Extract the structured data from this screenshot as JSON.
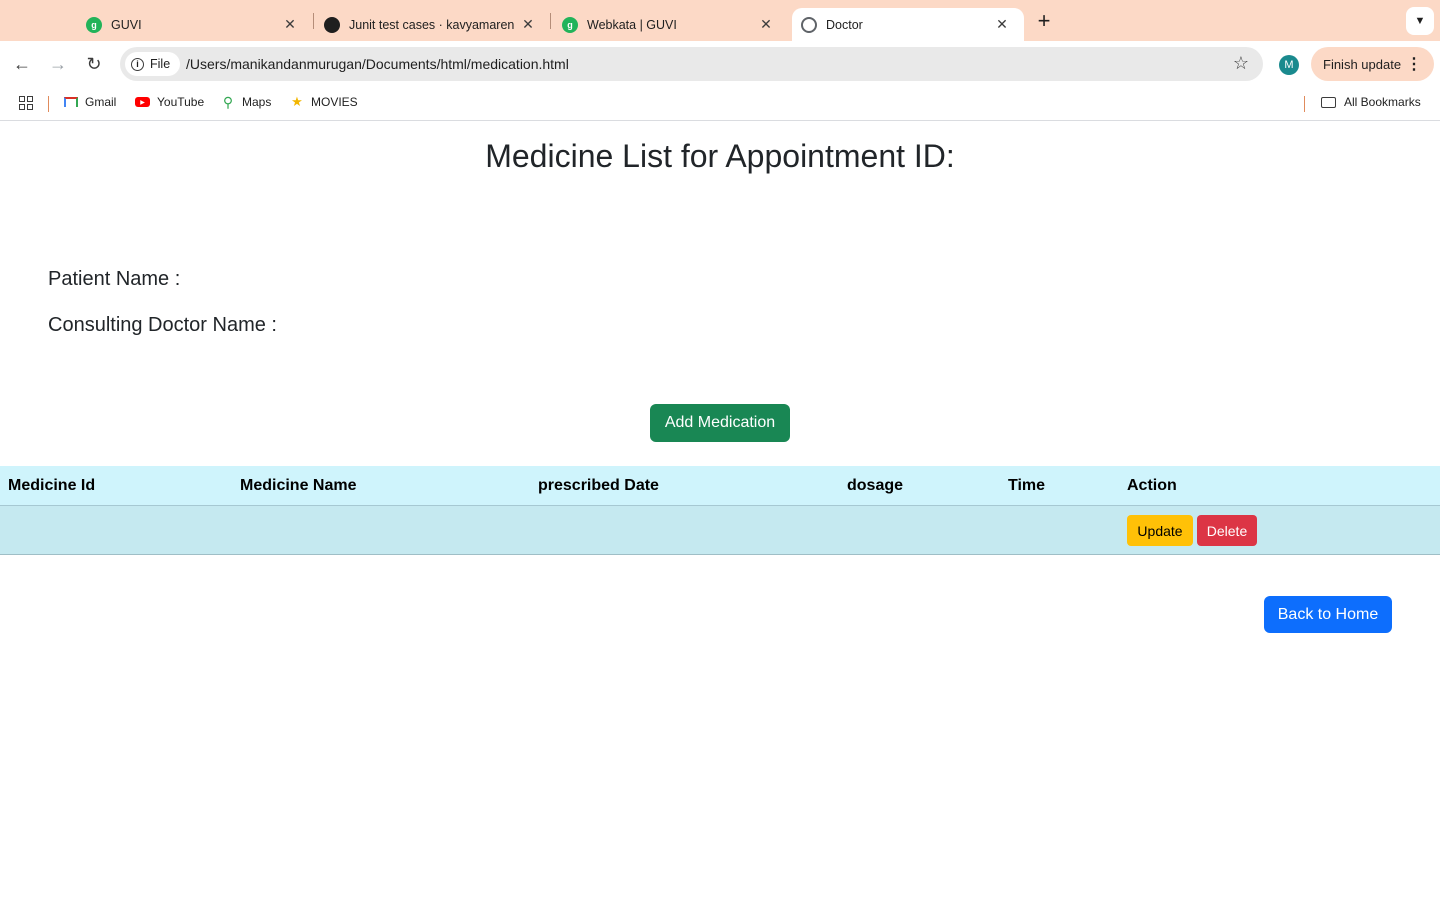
{
  "browser": {
    "tabs": [
      {
        "title": "GUVI",
        "icon": "guvi-icon"
      },
      {
        "title": "Junit test cases · kavyamaren",
        "icon": "github-icon"
      },
      {
        "title": "Webkata | GUVI",
        "icon": "guvi-icon"
      },
      {
        "title": "Doctor",
        "icon": "globe-icon",
        "active": true
      }
    ],
    "address": {
      "chip_label": "File",
      "url": "/Users/manikandanmurugan/Documents/html/medication.html"
    },
    "profile_initial": "M",
    "finish_update_label": "Finish update",
    "bookmarks": [
      {
        "label": "Gmail",
        "icon": "gmail-icon"
      },
      {
        "label": "YouTube",
        "icon": "youtube-icon"
      },
      {
        "label": "Maps",
        "icon": "maps-icon"
      },
      {
        "label": "MOVIES",
        "icon": "movies-icon"
      }
    ],
    "all_bookmarks_label": "All Bookmarks",
    "colors": {
      "tabstrip": "#fcd9c6"
    }
  },
  "page": {
    "title": "Medicine List for Appointment ID:",
    "patient_label": "Patient Name :",
    "doctor_label": "Consulting Doctor Name :",
    "add_button": "Add Medication",
    "table": {
      "headers": [
        "Medicine Id",
        "Medicine Name",
        "prescribed Date",
        "dosage",
        "Time",
        "Action"
      ],
      "row_actions": {
        "update": "Update",
        "delete": "Delete"
      }
    },
    "back_button": "Back to Home",
    "colors": {
      "add": "#198754",
      "update": "#ffc107",
      "delete": "#dc3545",
      "home": "#0d6efd",
      "table_header": "#cff4fc"
    }
  }
}
